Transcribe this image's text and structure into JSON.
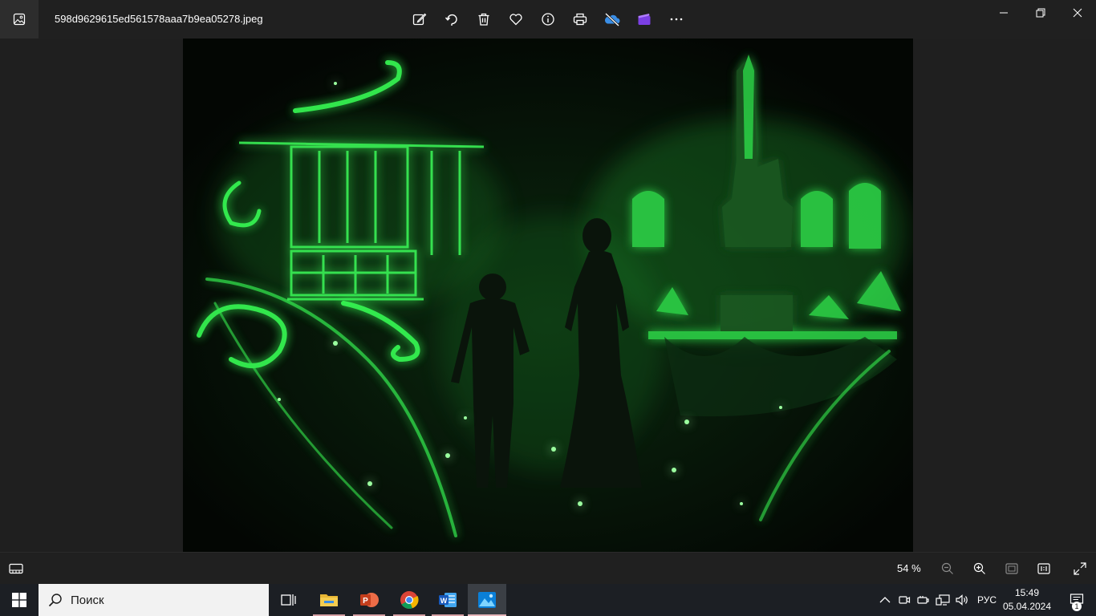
{
  "window": {
    "filename": "598d9629615ed561578aaa7b9ea05278.jpeg",
    "toolbar_icons": [
      "edit-icon",
      "rotate-icon",
      "delete-icon",
      "favorite-icon",
      "info-icon",
      "print-icon",
      "onedrive-icon",
      "clipchamp-icon",
      "more-icon"
    ],
    "controls": [
      "minimize-icon",
      "restore-icon",
      "close-icon"
    ]
  },
  "statusbar": {
    "zoom_label": "54 %"
  },
  "taskbar": {
    "search_placeholder": "Поиск",
    "apps": [
      "task-view",
      "file-explorer",
      "powerpoint",
      "chrome",
      "word",
      "photos"
    ],
    "language": "РУС",
    "time": "15:49",
    "date": "05.04.2024",
    "notification_count": "1"
  },
  "colors": {
    "glow": "#39ff55",
    "glow_dim": "#1c8a2a",
    "taskbar": "#1c1f24",
    "chrome": "#202020"
  }
}
